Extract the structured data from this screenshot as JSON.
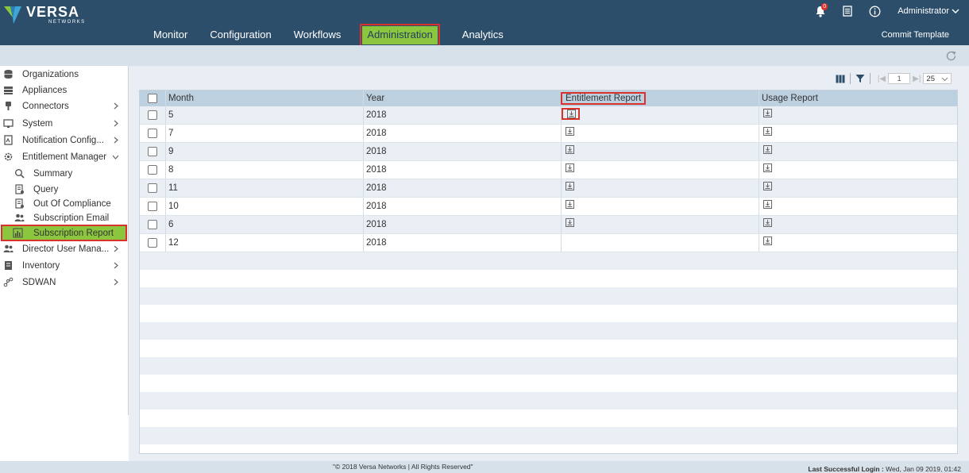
{
  "app": {
    "logo_text": "VERSA",
    "logo_subtext": "NETWORKS"
  },
  "header": {
    "nav": [
      "Monitor",
      "Configuration",
      "Workflows",
      "Administration",
      "Analytics"
    ],
    "active_nav": "Administration",
    "commit_label": "Commit Template",
    "user": "Administrator",
    "notifications_count": "0"
  },
  "sidebar": {
    "items": [
      {
        "label": "Organizations"
      },
      {
        "label": "Appliances"
      },
      {
        "label": "Connectors"
      },
      {
        "label": "System"
      },
      {
        "label": "Notification Config..."
      },
      {
        "label": "Entitlement Manager"
      },
      {
        "label": "Summary"
      },
      {
        "label": "Query"
      },
      {
        "label": "Out Of Compliance"
      },
      {
        "label": "Subscription Email"
      },
      {
        "label": "Subscription Report"
      },
      {
        "label": "Director User Mana..."
      },
      {
        "label": "Inventory"
      },
      {
        "label": "SDWAN"
      }
    ]
  },
  "toolbar": {
    "page": "1",
    "page_size": "25"
  },
  "table": {
    "columns": [
      "Month",
      "Year",
      "Entitlement Report",
      "Usage Report"
    ],
    "rows": [
      {
        "month": "5",
        "year": "2018",
        "entitlement": true,
        "usage": true
      },
      {
        "month": "7",
        "year": "2018",
        "entitlement": true,
        "usage": true
      },
      {
        "month": "9",
        "year": "2018",
        "entitlement": true,
        "usage": true
      },
      {
        "month": "8",
        "year": "2018",
        "entitlement": true,
        "usage": true
      },
      {
        "month": "11",
        "year": "2018",
        "entitlement": true,
        "usage": true
      },
      {
        "month": "10",
        "year": "2018",
        "entitlement": true,
        "usage": true
      },
      {
        "month": "6",
        "year": "2018",
        "entitlement": true,
        "usage": true
      },
      {
        "month": "12",
        "year": "2018",
        "entitlement": false,
        "usage": true
      }
    ]
  },
  "footer": {
    "copyright": "\"© 2018 Versa Networks | All Rights Reserved\"",
    "last_login_label": "Last Successful Login :",
    "last_login_value": " Wed, Jan 09 2019, 01:42"
  },
  "colors": {
    "header_bg": "#2c4e6a",
    "active_green": "#8cc63f",
    "highlight_red": "#d9312b",
    "grid_header": "#bdd0df"
  }
}
